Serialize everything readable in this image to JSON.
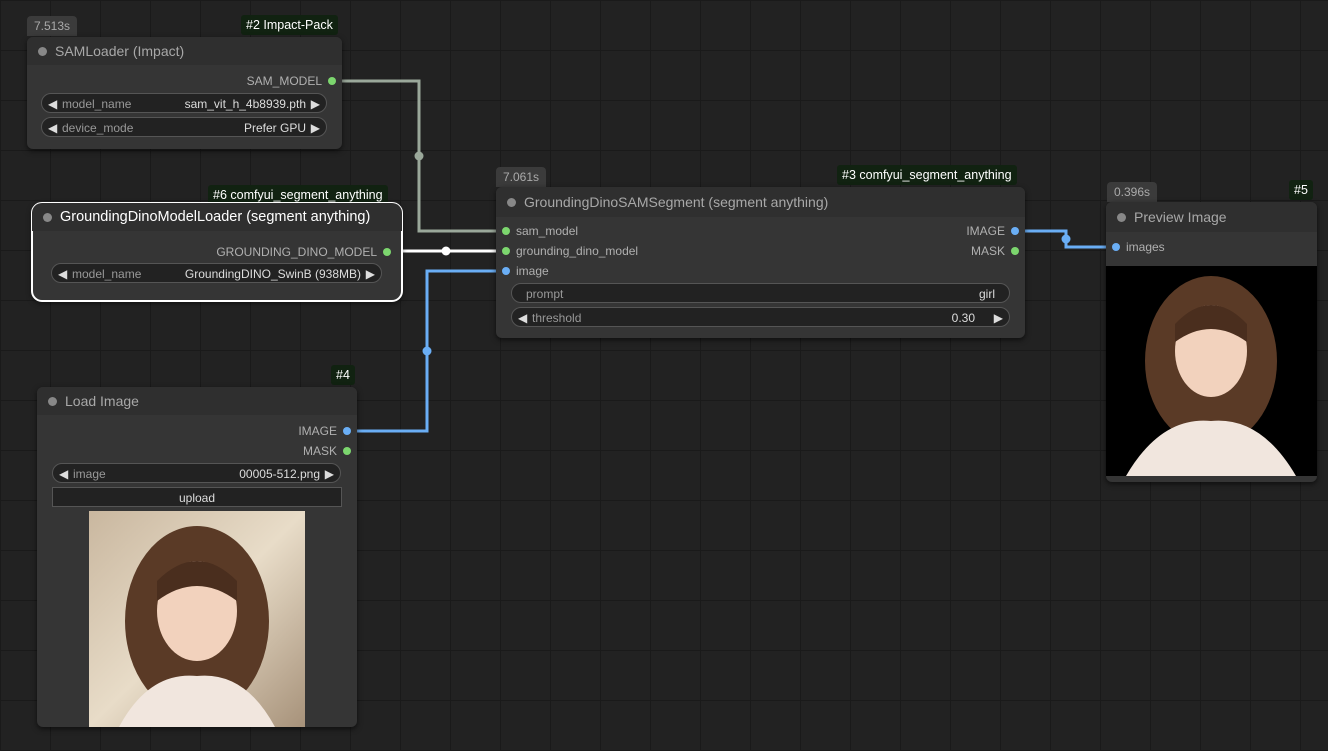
{
  "nodes": {
    "sam_loader": {
      "time": "7.513s",
      "id_badge": "#2 Impact-Pack",
      "title": "SAMLoader (Impact)",
      "output": "SAM_MODEL",
      "widgets": [
        {
          "label": "model_name",
          "value": "sam_vit_h_4b8939.pth"
        },
        {
          "label": "device_mode",
          "value": "Prefer GPU"
        }
      ]
    },
    "dino_loader": {
      "id_badge": "#6 comfyui_segment_anything",
      "title": "GroundingDinoModelLoader (segment anything)",
      "output": "GROUNDING_DINO_MODEL",
      "widget": {
        "label": "model_name",
        "value": "GroundingDINO_SwinB (938MB)"
      }
    },
    "segment": {
      "time": "7.061s",
      "id_badge": "#3 comfyui_segment_anything",
      "title": "GroundingDinoSAMSegment (segment anything)",
      "inputs": [
        "sam_model",
        "grounding_dino_model",
        "image"
      ],
      "outputs": [
        "IMAGE",
        "MASK"
      ],
      "prompt": {
        "label": "prompt",
        "value": "girl"
      },
      "threshold": {
        "label": "threshold",
        "value": "0.30"
      }
    },
    "load_image": {
      "id_badge": "#4",
      "title": "Load Image",
      "outputs": [
        "IMAGE",
        "MASK"
      ],
      "widget": {
        "label": "image",
        "value": "00005-512.png"
      },
      "upload_label": "upload"
    },
    "preview": {
      "time": "0.396s",
      "id_badge": "#5",
      "title": "Preview Image",
      "input": "images"
    }
  },
  "colors": {
    "canvas": "#222222",
    "node_body": "#353535",
    "link_sam": "#9aa89a",
    "link_dino": "#ffffff",
    "link_image": "#6aaef5",
    "slot_green": "#7cd66e",
    "slot_blue": "#6aaef5",
    "id_badge_bg": "#112211"
  },
  "icons": {
    "arrow_left": "◀",
    "arrow_right": "▶"
  }
}
